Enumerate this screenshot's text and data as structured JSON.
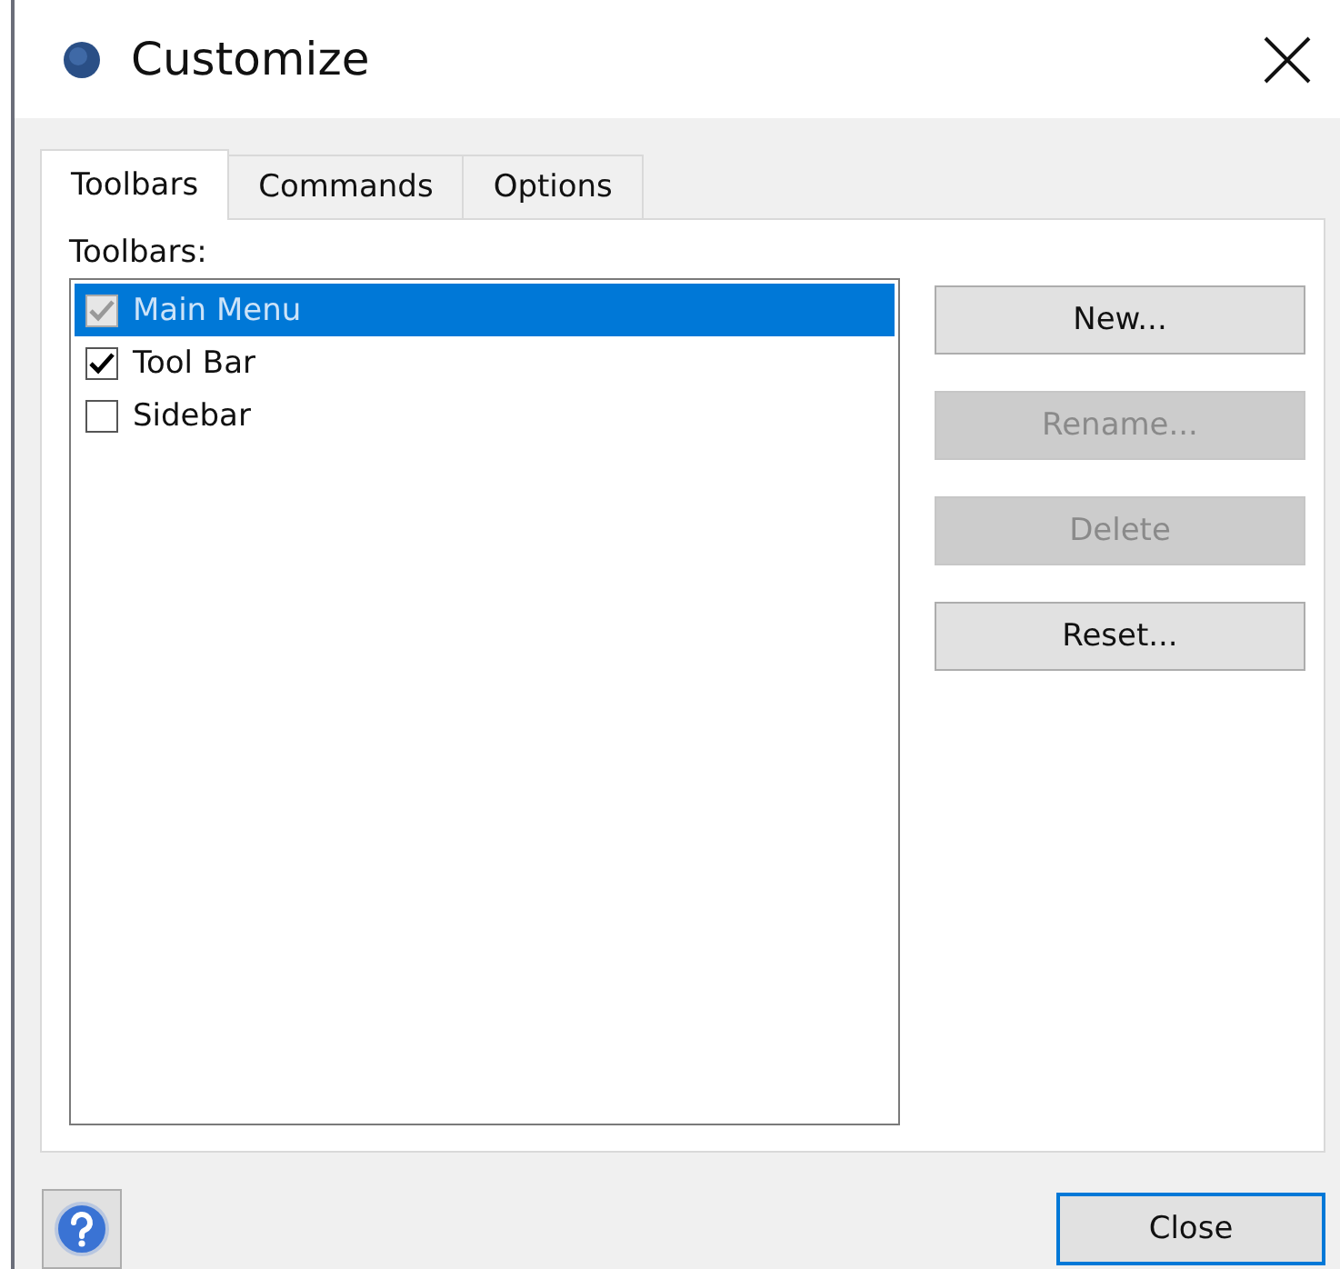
{
  "window": {
    "title": "Customize"
  },
  "tabs": [
    {
      "label": "Toolbars",
      "selected": true
    },
    {
      "label": "Commands",
      "selected": false
    },
    {
      "label": "Options",
      "selected": false
    }
  ],
  "toolbars_label": "Toolbars:",
  "toolbars": [
    {
      "label": "Main Menu",
      "checked": true,
      "disabled": true,
      "selected": true
    },
    {
      "label": "Tool Bar",
      "checked": true,
      "disabled": false,
      "selected": false
    },
    {
      "label": "Sidebar",
      "checked": false,
      "disabled": false,
      "selected": false
    }
  ],
  "buttons": [
    {
      "label": "New...",
      "disabled": false
    },
    {
      "label": "Rename...",
      "disabled": true
    },
    {
      "label": "Delete",
      "disabled": true
    },
    {
      "label": "Reset..."
    }
  ],
  "close_button": "Close"
}
